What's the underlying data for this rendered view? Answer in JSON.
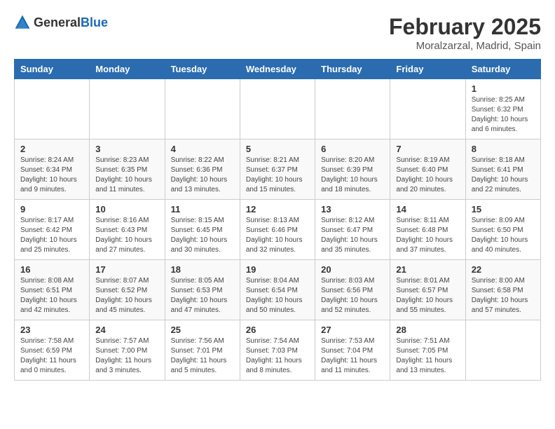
{
  "logo": {
    "general": "General",
    "blue": "Blue"
  },
  "title": "February 2025",
  "location": "Moralzarzal, Madrid, Spain",
  "weekdays": [
    "Sunday",
    "Monday",
    "Tuesday",
    "Wednesday",
    "Thursday",
    "Friday",
    "Saturday"
  ],
  "weeks": [
    [
      null,
      null,
      null,
      null,
      null,
      null,
      {
        "day": "1",
        "sunrise": "Sunrise: 8:25 AM",
        "sunset": "Sunset: 6:32 PM",
        "daylight": "Daylight: 10 hours and 6 minutes."
      }
    ],
    [
      {
        "day": "2",
        "sunrise": "Sunrise: 8:24 AM",
        "sunset": "Sunset: 6:34 PM",
        "daylight": "Daylight: 10 hours and 9 minutes."
      },
      {
        "day": "3",
        "sunrise": "Sunrise: 8:23 AM",
        "sunset": "Sunset: 6:35 PM",
        "daylight": "Daylight: 10 hours and 11 minutes."
      },
      {
        "day": "4",
        "sunrise": "Sunrise: 8:22 AM",
        "sunset": "Sunset: 6:36 PM",
        "daylight": "Daylight: 10 hours and 13 minutes."
      },
      {
        "day": "5",
        "sunrise": "Sunrise: 8:21 AM",
        "sunset": "Sunset: 6:37 PM",
        "daylight": "Daylight: 10 hours and 15 minutes."
      },
      {
        "day": "6",
        "sunrise": "Sunrise: 8:20 AM",
        "sunset": "Sunset: 6:39 PM",
        "daylight": "Daylight: 10 hours and 18 minutes."
      },
      {
        "day": "7",
        "sunrise": "Sunrise: 8:19 AM",
        "sunset": "Sunset: 6:40 PM",
        "daylight": "Daylight: 10 hours and 20 minutes."
      },
      {
        "day": "8",
        "sunrise": "Sunrise: 8:18 AM",
        "sunset": "Sunset: 6:41 PM",
        "daylight": "Daylight: 10 hours and 22 minutes."
      }
    ],
    [
      {
        "day": "9",
        "sunrise": "Sunrise: 8:17 AM",
        "sunset": "Sunset: 6:42 PM",
        "daylight": "Daylight: 10 hours and 25 minutes."
      },
      {
        "day": "10",
        "sunrise": "Sunrise: 8:16 AM",
        "sunset": "Sunset: 6:43 PM",
        "daylight": "Daylight: 10 hours and 27 minutes."
      },
      {
        "day": "11",
        "sunrise": "Sunrise: 8:15 AM",
        "sunset": "Sunset: 6:45 PM",
        "daylight": "Daylight: 10 hours and 30 minutes."
      },
      {
        "day": "12",
        "sunrise": "Sunrise: 8:13 AM",
        "sunset": "Sunset: 6:46 PM",
        "daylight": "Daylight: 10 hours and 32 minutes."
      },
      {
        "day": "13",
        "sunrise": "Sunrise: 8:12 AM",
        "sunset": "Sunset: 6:47 PM",
        "daylight": "Daylight: 10 hours and 35 minutes."
      },
      {
        "day": "14",
        "sunrise": "Sunrise: 8:11 AM",
        "sunset": "Sunset: 6:48 PM",
        "daylight": "Daylight: 10 hours and 37 minutes."
      },
      {
        "day": "15",
        "sunrise": "Sunrise: 8:09 AM",
        "sunset": "Sunset: 6:50 PM",
        "daylight": "Daylight: 10 hours and 40 minutes."
      }
    ],
    [
      {
        "day": "16",
        "sunrise": "Sunrise: 8:08 AM",
        "sunset": "Sunset: 6:51 PM",
        "daylight": "Daylight: 10 hours and 42 minutes."
      },
      {
        "day": "17",
        "sunrise": "Sunrise: 8:07 AM",
        "sunset": "Sunset: 6:52 PM",
        "daylight": "Daylight: 10 hours and 45 minutes."
      },
      {
        "day": "18",
        "sunrise": "Sunrise: 8:05 AM",
        "sunset": "Sunset: 6:53 PM",
        "daylight": "Daylight: 10 hours and 47 minutes."
      },
      {
        "day": "19",
        "sunrise": "Sunrise: 8:04 AM",
        "sunset": "Sunset: 6:54 PM",
        "daylight": "Daylight: 10 hours and 50 minutes."
      },
      {
        "day": "20",
        "sunrise": "Sunrise: 8:03 AM",
        "sunset": "Sunset: 6:56 PM",
        "daylight": "Daylight: 10 hours and 52 minutes."
      },
      {
        "day": "21",
        "sunrise": "Sunrise: 8:01 AM",
        "sunset": "Sunset: 6:57 PM",
        "daylight": "Daylight: 10 hours and 55 minutes."
      },
      {
        "day": "22",
        "sunrise": "Sunrise: 8:00 AM",
        "sunset": "Sunset: 6:58 PM",
        "daylight": "Daylight: 10 hours and 57 minutes."
      }
    ],
    [
      {
        "day": "23",
        "sunrise": "Sunrise: 7:58 AM",
        "sunset": "Sunset: 6:59 PM",
        "daylight": "Daylight: 11 hours and 0 minutes."
      },
      {
        "day": "24",
        "sunrise": "Sunrise: 7:57 AM",
        "sunset": "Sunset: 7:00 PM",
        "daylight": "Daylight: 11 hours and 3 minutes."
      },
      {
        "day": "25",
        "sunrise": "Sunrise: 7:56 AM",
        "sunset": "Sunset: 7:01 PM",
        "daylight": "Daylight: 11 hours and 5 minutes."
      },
      {
        "day": "26",
        "sunrise": "Sunrise: 7:54 AM",
        "sunset": "Sunset: 7:03 PM",
        "daylight": "Daylight: 11 hours and 8 minutes."
      },
      {
        "day": "27",
        "sunrise": "Sunrise: 7:53 AM",
        "sunset": "Sunset: 7:04 PM",
        "daylight": "Daylight: 11 hours and 11 minutes."
      },
      {
        "day": "28",
        "sunrise": "Sunrise: 7:51 AM",
        "sunset": "Sunset: 7:05 PM",
        "daylight": "Daylight: 11 hours and 13 minutes."
      },
      null
    ]
  ]
}
